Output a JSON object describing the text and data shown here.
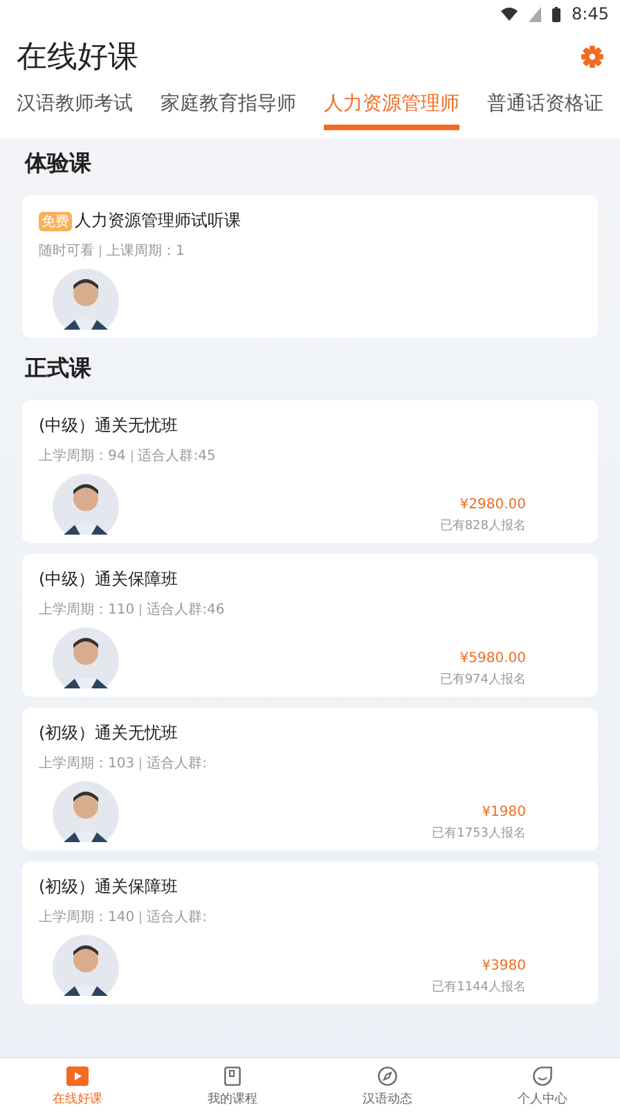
{
  "status_bar": {
    "time": "8:45"
  },
  "header": {
    "title": "在线好课"
  },
  "tabs": [
    {
      "label": "汉语教师考试",
      "selected": false
    },
    {
      "label": "家庭教育指导师",
      "selected": false
    },
    {
      "label": "人力资源管理师",
      "selected": true
    },
    {
      "label": "普通话资格证",
      "selected": false
    }
  ],
  "trial_section": {
    "heading": "体验课",
    "courses": [
      {
        "badge": "免费",
        "title": "人力资源管理师试听课",
        "meta": [
          "随时可看",
          "上课周期：1"
        ]
      }
    ]
  },
  "formal_section": {
    "heading": "正式课",
    "courses": [
      {
        "title": "(中级）通关无忧班",
        "meta": [
          "上学周期：94",
          "适合人群:45"
        ],
        "price": "¥2980.00",
        "enrolled": "已有828人报名"
      },
      {
        "title": "(中级）通关保障班",
        "meta": [
          "上学周期：110",
          "适合人群:46"
        ],
        "price": "¥5980.00",
        "enrolled": "已有974人报名"
      },
      {
        "title": "(初级）通关无忧班",
        "meta": [
          "上学周期：103",
          "适合人群:"
        ],
        "price": "¥1980",
        "enrolled": "已有1753人报名"
      },
      {
        "title": "(初级）通关保障班",
        "meta": [
          "上学周期：140",
          "适合人群:"
        ],
        "price": "¥3980",
        "enrolled": "已有1144人报名"
      }
    ]
  },
  "bottom_nav": [
    {
      "label": "在线好课",
      "kind": "play",
      "selected": true
    },
    {
      "label": "我的课程",
      "kind": "book",
      "selected": false
    },
    {
      "label": "汉语动态",
      "kind": "compass",
      "selected": false
    },
    {
      "label": "个人中心",
      "kind": "face",
      "selected": false
    }
  ]
}
